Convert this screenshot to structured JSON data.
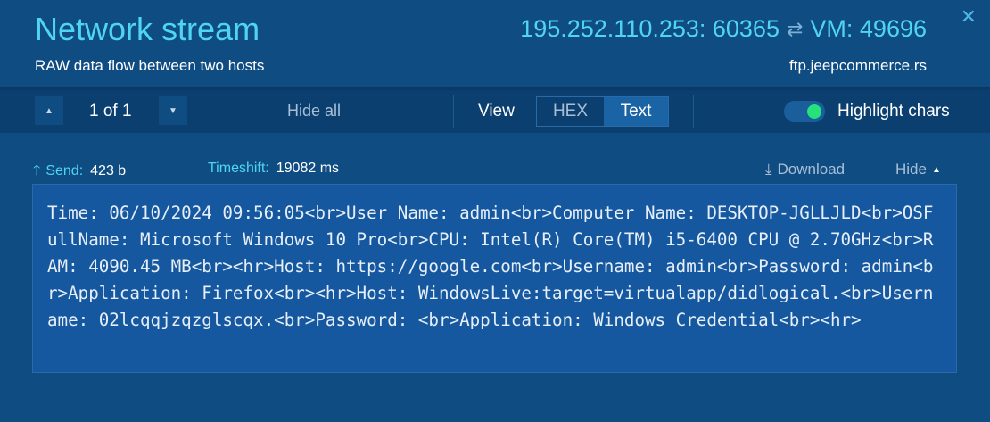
{
  "header": {
    "title": "Network stream",
    "subtitle": "RAW data flow between two hosts",
    "source": "195.252.110.253: 60365",
    "swap_glyph": "⇄",
    "destination": "VM: 49696",
    "domain": "ftp.jeepcommerce.rs",
    "close_glyph": "✕"
  },
  "toolbar": {
    "prev_glyph": "▲",
    "next_glyph": "▼",
    "page_indicator": "1 of 1",
    "hide_all": "Hide all",
    "view_label": "View",
    "view_options": [
      "HEX",
      "Text"
    ],
    "view_selected": "Text",
    "highlight_label": "Highlight chars",
    "highlight_on": true
  },
  "stream": {
    "direction_glyph": "🡑",
    "send_label": "Send:",
    "send_value": "423 b",
    "timeshift_label": "Timeshift:",
    "timeshift_value": "19082 ms",
    "download_glyph": "⤓",
    "download_label": "Download",
    "hide_label": "Hide",
    "hide_glyph": "▲",
    "content": "Time: 06/10/2024 09:56:05<br>User Name: admin<br>Computer Name: DESKTOP-JGLLJLD<br>OSFullName: Microsoft Windows 10 Pro<br>CPU: Intel(R) Core(TM) i5-6400 CPU @ 2.70GHz<br>RAM: 4090.45 MB<br><hr>Host: https://google.com<br>Username: admin<br>Password: admin<br>Application: Firefox<br><hr>Host: WindowsLive:target=virtualapp/didlogical.<br>Username: 02lcqqjzqzglscqx.<br>Password: <br>Application: Windows Credential<br><hr>"
  },
  "colors": {
    "background": "#0f4c82",
    "toolbar": "#0b3f6f",
    "accent": "#4fd5f2",
    "toggle_on": "#25e37a",
    "panel": "#1558a0"
  }
}
